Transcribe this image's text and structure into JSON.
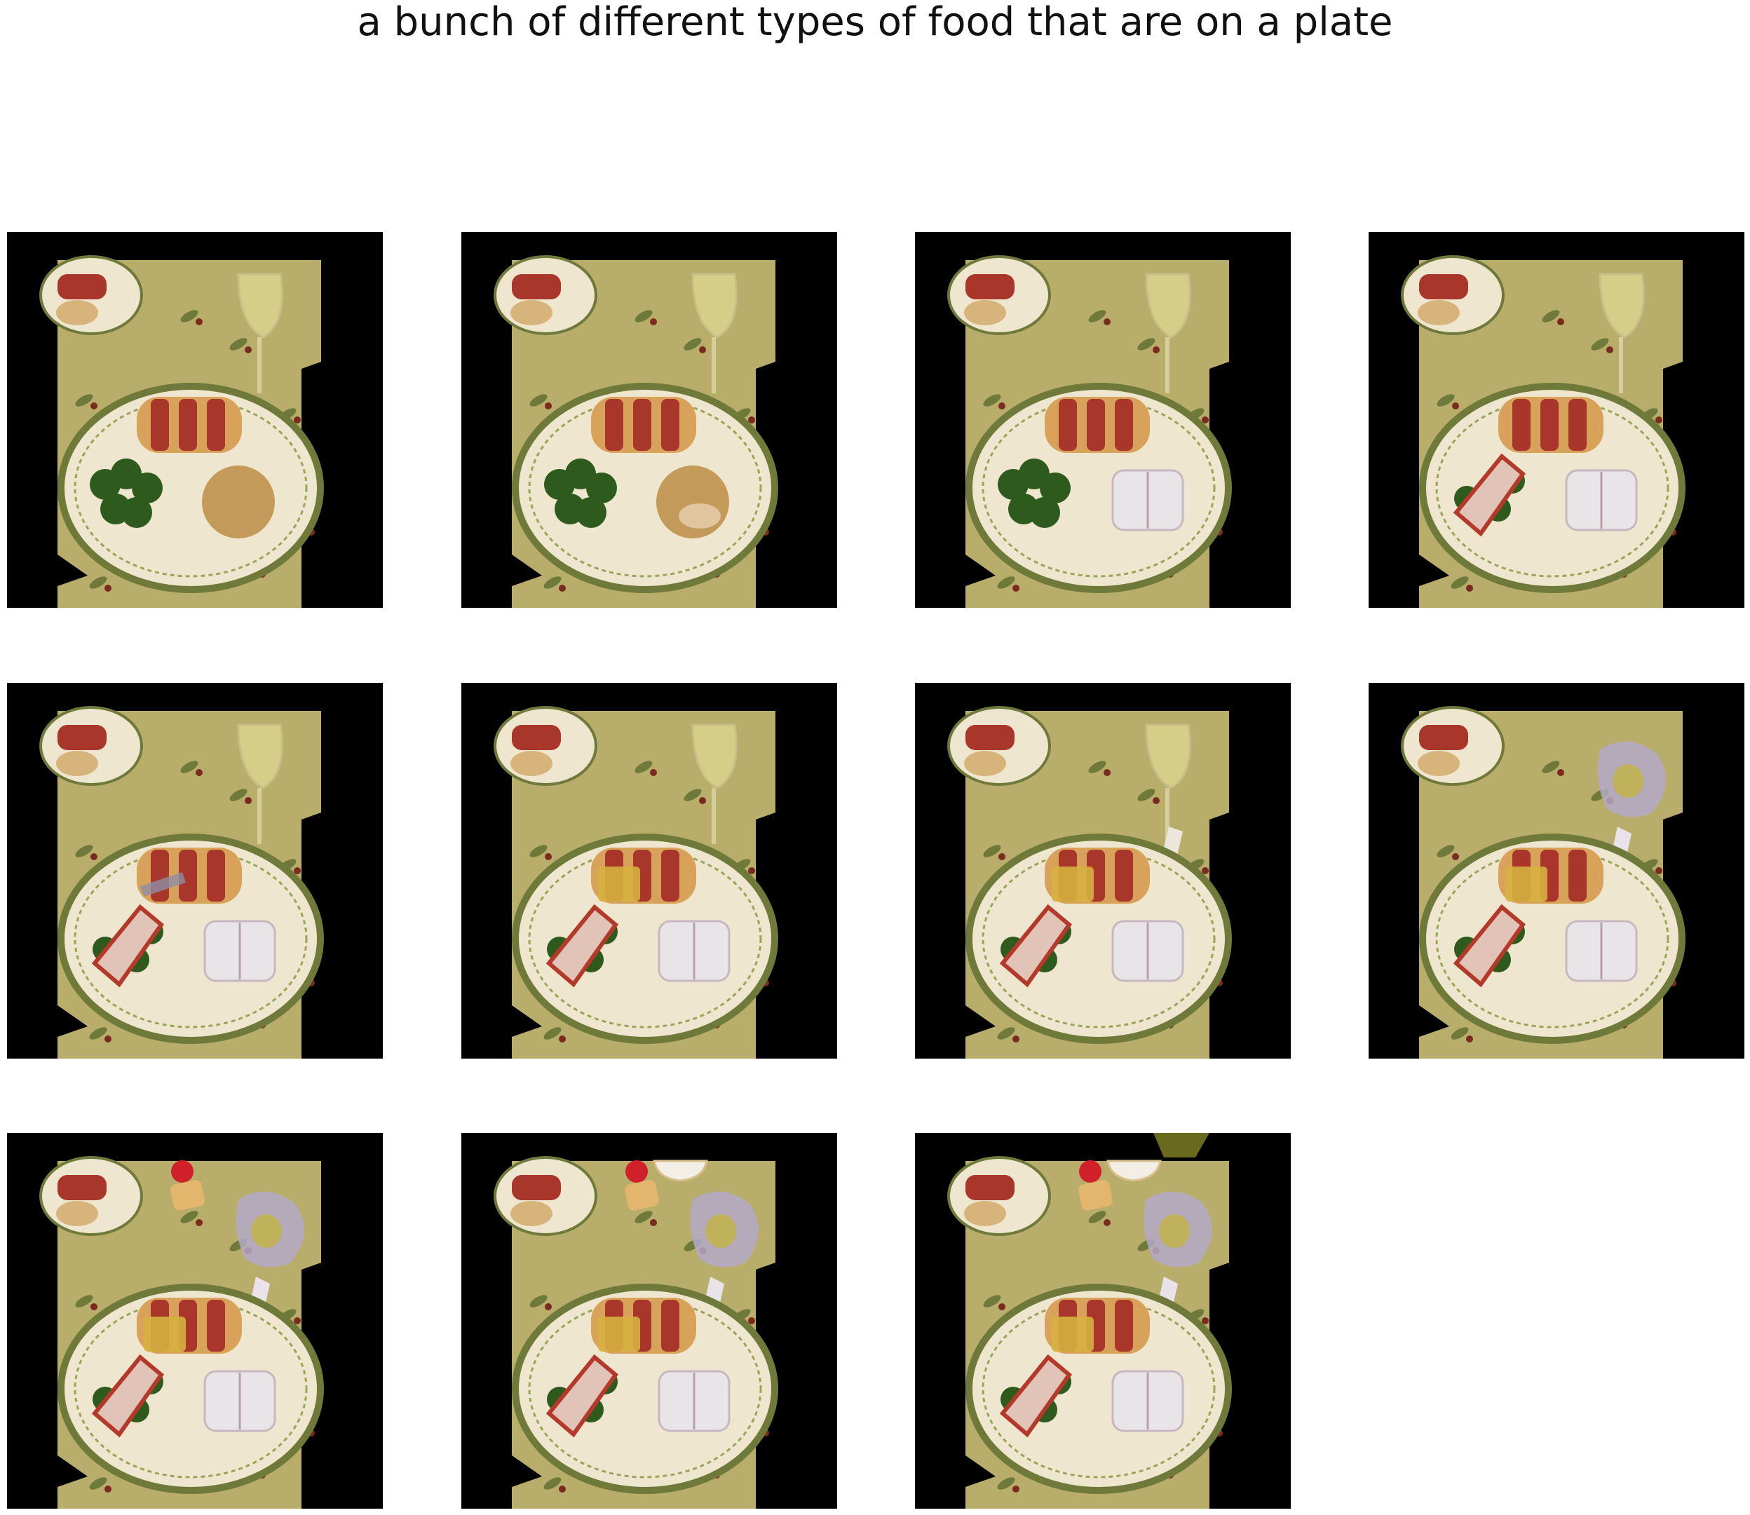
{
  "title": "a bunch of different types of food that are on a plate",
  "colors": {
    "background": "#ffffff",
    "panel_background": "#000000",
    "tablecloth": "#b9ad6c",
    "plate": "#efe6cf",
    "plate_rim": "#6f7a3a",
    "meat": "#a8362a",
    "pastry": "#d9a25a",
    "broccoli": "#2f5a1e",
    "bun": "#c49a5a",
    "sandwich_bread": "#e8e4e8",
    "wine": "#d8cf8a"
  },
  "panels": [
    {
      "right_item": "bun",
      "left_item": "broccoli",
      "roll": "plain",
      "glass": "wine-glass",
      "extra_top": []
    },
    {
      "right_item": "bun-glazed",
      "left_item": "broccoli",
      "roll": "plain",
      "glass": "wine-glass",
      "extra_top": []
    },
    {
      "right_item": "sandwich-bread",
      "left_item": "broccoli",
      "roll": "plain",
      "glass": "wine-glass",
      "extra_top": []
    },
    {
      "right_item": "sandwich-bread",
      "left_item": "sandwich-slice",
      "roll": "plain",
      "glass": "wine-glass",
      "extra_top": []
    },
    {
      "right_item": "sandwich-bread",
      "left_item": "sandwich-slice",
      "roll": "smudged",
      "glass": "wine-glass",
      "extra_top": []
    },
    {
      "right_item": "sandwich-bread",
      "left_item": "sandwich-slice",
      "roll": "yellow-patch",
      "glass": "wine-glass",
      "extra_top": []
    },
    {
      "right_item": "sandwich-bread",
      "left_item": "sandwich-slice",
      "roll": "yellow-patch",
      "glass": "wine-glass-drip",
      "extra_top": []
    },
    {
      "right_item": "sandwich-bread",
      "left_item": "sandwich-slice",
      "roll": "yellow-patch",
      "glass": "purple-glass",
      "extra_top": []
    },
    {
      "right_item": "sandwich-bread",
      "left_item": "sandwich-slice",
      "roll": "yellow-patch",
      "glass": "purple-glass",
      "extra_top": [
        "cake-cherry"
      ]
    },
    {
      "right_item": "sandwich-bread",
      "left_item": "sandwich-slice",
      "roll": "yellow-patch",
      "glass": "purple-glass",
      "extra_top": [
        "cake-cherry",
        "bowl"
      ]
    },
    {
      "right_item": "sandwich-bread",
      "left_item": "sandwich-slice",
      "roll": "yellow-patch",
      "glass": "purple-glass",
      "extra_top": [
        "cake-cherry",
        "bowl",
        "leaf"
      ]
    }
  ]
}
